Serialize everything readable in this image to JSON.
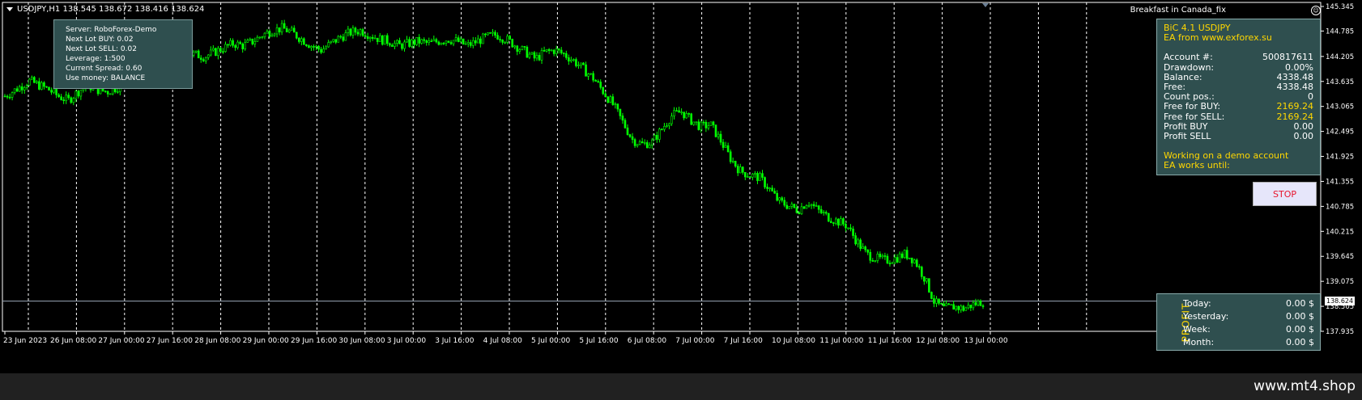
{
  "window": {
    "symbol_info": "USDJPY,H1  138.545 138.672 138.416 138.624",
    "template": "Breakfast in Canada_fix"
  },
  "info_box": {
    "lines": [
      "Server: RoboForex-Demo",
      "Next Lot BUY: 0.02",
      "Next Lot SELL: 0.02",
      "Leverage: 1:500",
      "Current Spread: 0.60",
      "Use money: BALANCE"
    ]
  },
  "ea_panel": {
    "title": "BiC 4.1 USDJPY",
    "subtitle": "EA from www.exforex.su",
    "rows": [
      {
        "label": "Account #:",
        "value": "500817611",
        "highlight": false
      },
      {
        "label": "Drawdown:",
        "value": "0.00%",
        "highlight": false
      },
      {
        "label": "Balance:",
        "value": "4338.48",
        "highlight": false
      },
      {
        "label": "Free:",
        "value": "4338.48",
        "highlight": false
      },
      {
        "label": "Count pos.:",
        "value": "0",
        "highlight": false
      },
      {
        "label": "Free for BUY:",
        "value": "2169.24",
        "highlight": true
      },
      {
        "label": "Free for SELL:",
        "value": "2169.24",
        "highlight": true
      },
      {
        "label": "Profit BUY",
        "value": "0.00",
        "highlight": false
      },
      {
        "label": "Profit SELL",
        "value": "0.00",
        "highlight": false
      }
    ],
    "status": "Working on a demo account",
    "works_until": "EA works until:",
    "stop_label": "STOP"
  },
  "profit_panel": {
    "title": "PROFIT",
    "rows": [
      {
        "label": "Today:",
        "value": "0.00 $"
      },
      {
        "label": "Yesterday:",
        "value": "0.00 $"
      },
      {
        "label": "Week:",
        "value": "0.00 $"
      },
      {
        "label": "Month:",
        "value": "0.00 $"
      }
    ]
  },
  "current_price": "138.624",
  "footer": {
    "site": "www.mt4.shop"
  },
  "colors": {
    "candles": "#00ff00",
    "panel_bg": "#2f4f4f",
    "accent": "#ffd700",
    "stop_text": "#e8152d"
  },
  "chart_data": {
    "type": "candlestick",
    "symbol": "USDJPY",
    "timeframe": "H1",
    "ylim": [
      137.935,
      145.345
    ],
    "y_ticks": [
      "145.345",
      "144.785",
      "144.205",
      "143.635",
      "143.065",
      "142.495",
      "141.925",
      "141.355",
      "140.785",
      "140.215",
      "139.645",
      "139.075",
      "138.505",
      "137.935"
    ],
    "x_ticks": [
      "23 Jun 2023",
      "26 Jun 08:00",
      "27 Jun 00:00",
      "27 Jun 16:00",
      "28 Jun 08:00",
      "29 Jun 00:00",
      "29 Jun 16:00",
      "30 Jun 08:00",
      "3 Jul 00:00",
      "3 Jul 16:00",
      "4 Jul 08:00",
      "5 Jul 00:00",
      "5 Jul 16:00",
      "6 Jul 08:00",
      "7 Jul 00:00",
      "7 Jul 16:00",
      "10 Jul 08:00",
      "11 Jul 00:00",
      "11 Jul 16:00",
      "12 Jul 08:00",
      "13 Jul 00:00"
    ],
    "current_price": 138.624,
    "price_path": [
      [
        0,
        143.3
      ],
      [
        3,
        143.5
      ],
      [
        5,
        143.65
      ],
      [
        7,
        143.55
      ],
      [
        9,
        143.45
      ],
      [
        11,
        143.3
      ],
      [
        13,
        143.2
      ],
      [
        15,
        143.4
      ],
      [
        17,
        143.55
      ],
      [
        19,
        143.45
      ],
      [
        21,
        143.4
      ],
      [
        23,
        143.5
      ],
      [
        25,
        143.6
      ],
      [
        27,
        143.75
      ],
      [
        29,
        143.85
      ],
      [
        31,
        144.0
      ],
      [
        33,
        144.1
      ],
      [
        35,
        144.2
      ],
      [
        37,
        144.3
      ],
      [
        39,
        144.25
      ],
      [
        41,
        144.2
      ],
      [
        43,
        144.3
      ],
      [
        45,
        144.4
      ],
      [
        47,
        144.5
      ],
      [
        49,
        144.45
      ],
      [
        51,
        144.55
      ],
      [
        53,
        144.7
      ],
      [
        55,
        144.8
      ],
      [
        57,
        144.85
      ],
      [
        59,
        144.75
      ],
      [
        61,
        144.6
      ],
      [
        63,
        144.45
      ],
      [
        65,
        144.35
      ],
      [
        67,
        144.5
      ],
      [
        69,
        144.65
      ],
      [
        71,
        144.75
      ],
      [
        73,
        144.8
      ],
      [
        75,
        144.7
      ],
      [
        77,
        144.6
      ],
      [
        79,
        144.55
      ],
      [
        81,
        144.45
      ],
      [
        83,
        144.5
      ],
      [
        85,
        144.55
      ],
      [
        87,
        144.5
      ],
      [
        89,
        144.55
      ],
      [
        91,
        144.6
      ],
      [
        93,
        144.55
      ],
      [
        95,
        144.45
      ],
      [
        97,
        144.55
      ],
      [
        99,
        144.65
      ],
      [
        101,
        144.7
      ],
      [
        103,
        144.6
      ],
      [
        105,
        144.45
      ],
      [
        107,
        144.3
      ],
      [
        109,
        144.15
      ],
      [
        111,
        144.3
      ],
      [
        113,
        144.35
      ],
      [
        115,
        144.25
      ],
      [
        117,
        144.1
      ],
      [
        119,
        143.9
      ],
      [
        121,
        143.7
      ],
      [
        123,
        143.4
      ],
      [
        125,
        143.1
      ],
      [
        127,
        142.7
      ],
      [
        129,
        142.3
      ],
      [
        131,
        142.2
      ],
      [
        133,
        142.25
      ],
      [
        135,
        142.55
      ],
      [
        137,
        142.85
      ],
      [
        139,
        142.95
      ],
      [
        141,
        142.75
      ],
      [
        143,
        142.6
      ],
      [
        145,
        142.65
      ],
      [
        147,
        142.3
      ],
      [
        149,
        141.9
      ],
      [
        151,
        141.6
      ],
      [
        153,
        141.5
      ],
      [
        155,
        141.45
      ],
      [
        157,
        141.2
      ],
      [
        159,
        140.9
      ],
      [
        161,
        140.8
      ],
      [
        163,
        140.7
      ],
      [
        165,
        140.9
      ],
      [
        167,
        140.7
      ],
      [
        169,
        140.55
      ],
      [
        171,
        140.45
      ],
      [
        173,
        140.35
      ],
      [
        175,
        140.0
      ],
      [
        177,
        139.7
      ],
      [
        179,
        139.6
      ],
      [
        181,
        139.55
      ],
      [
        183,
        139.6
      ],
      [
        185,
        139.7
      ],
      [
        187,
        139.55
      ],
      [
        189,
        139.15
      ],
      [
        191,
        138.6
      ],
      [
        193,
        138.45
      ],
      [
        195,
        138.5
      ],
      [
        197,
        138.45
      ],
      [
        199,
        138.55
      ],
      [
        201,
        138.62
      ]
    ]
  }
}
